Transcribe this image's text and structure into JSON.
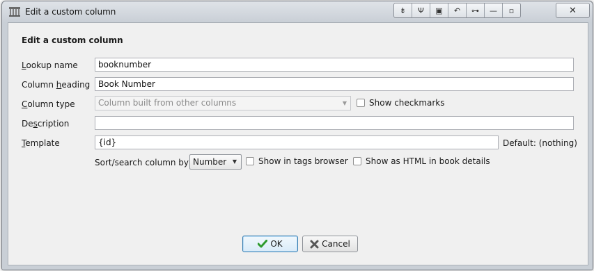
{
  "window": {
    "title": "Edit a custom column",
    "icons": [
      "app-library-icon"
    ],
    "titlebar_buttons": [
      {
        "name": "rollup-icon",
        "glyph": "⇟"
      },
      {
        "name": "pin-icon",
        "glyph": "Ψ"
      },
      {
        "name": "window-menu-icon",
        "glyph": "▣"
      },
      {
        "name": "undo-icon",
        "glyph": "↶"
      },
      {
        "name": "shade-icon",
        "glyph": "⊶"
      },
      {
        "name": "minimize-icon",
        "glyph": "—"
      },
      {
        "name": "maximize-icon",
        "glyph": "▫"
      }
    ],
    "close_glyph": "✕"
  },
  "dialog": {
    "heading": "Edit a custom column",
    "lookup_name": {
      "label_key": "L",
      "label_rest": "ookup name",
      "value": "booknumber"
    },
    "column_heading": {
      "label_pre": "Column ",
      "label_key": "h",
      "label_rest": "eading",
      "value": "Book Number"
    },
    "column_type": {
      "label_key": "C",
      "label_rest": "olumn type",
      "value": "Column built from other columns",
      "disabled": true
    },
    "show_checkmarks": {
      "label": "Show checkmarks",
      "checked": false
    },
    "description": {
      "label_pre": "De",
      "label_key": "s",
      "label_rest": "cription",
      "value": ""
    },
    "template": {
      "label_key": "T",
      "label_rest": "emplate",
      "value": "{id}",
      "default_text": "Default: (nothing)"
    },
    "sort_search": {
      "label": "Sort/search column by",
      "value": "Number"
    },
    "show_in_tags_browser": {
      "label": "Show in tags browser",
      "checked": false
    },
    "show_as_html": {
      "label": "Show as HTML in book details",
      "checked": false
    }
  },
  "buttons": {
    "ok": "OK",
    "cancel": "Cancel"
  },
  "colors": {
    "ok_check": "#2e9b2e",
    "cancel_x": "#555555",
    "default_button_border": "#3c7fb1"
  }
}
